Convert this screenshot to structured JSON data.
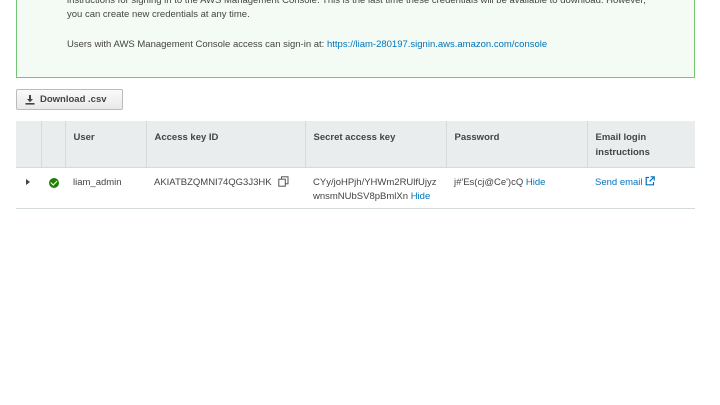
{
  "banner": {
    "line1": "instructions for signing in to the AWS Management Console. This is the last time these credentials will be available to download. However,",
    "line2": "you can create new credentials at any time.",
    "signin_text": "Users with AWS Management Console access can sign-in at: ",
    "signin_url": "https://liam-280197.signin.aws.amazon.com/console"
  },
  "download_button": {
    "label": "Download .csv",
    "icon": "download-icon"
  },
  "table": {
    "headers": [
      "User",
      "Access key ID",
      "Secret access key",
      "Password",
      "Email login instructions"
    ],
    "rows": [
      {
        "status_icon": "check-circle-icon",
        "user": "liam_admin",
        "access_key_id": "AKIATBZQMNI74QG3J3HK",
        "secret_line1": "CYy/joHPjh/YHWm2RUlfUjyz",
        "secret_line2": "wnsmNUbSV8pBmlXn",
        "secret_hide": "Hide",
        "password": "j#'Es(cj@Ce')cQ",
        "password_hide": "Hide",
        "email_action": "Send email"
      }
    ]
  },
  "colors": {
    "link": "#0073bb",
    "success": "#1d8102",
    "banner_border": "#74c674",
    "header_bg": "#eaeded"
  }
}
